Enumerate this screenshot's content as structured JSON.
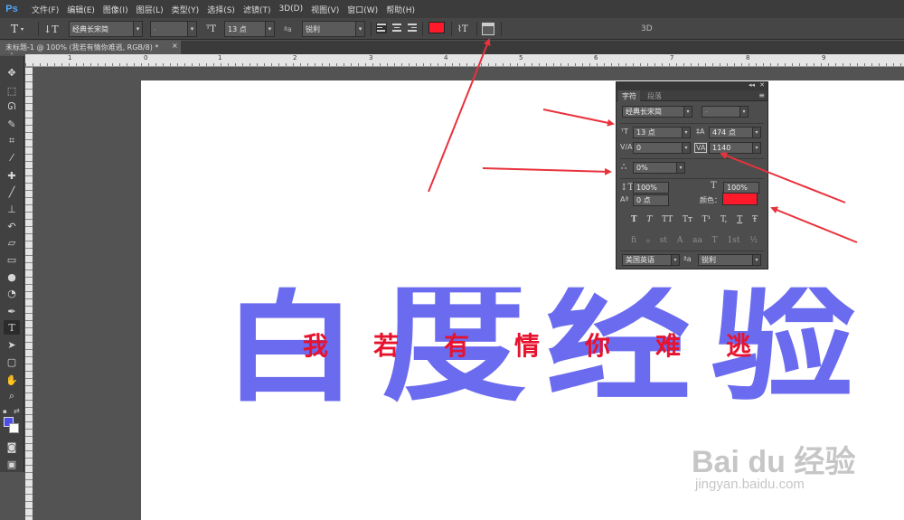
{
  "app": {
    "logo": "Ps"
  },
  "menu": [
    "文件(F)",
    "编辑(E)",
    "图像(I)",
    "图层(L)",
    "类型(Y)",
    "选择(S)",
    "滤镜(T)",
    "3D(D)",
    "视图(V)",
    "窗口(W)",
    "帮助(H)"
  ],
  "options": {
    "font_family": "经典长宋简",
    "font_style": "-",
    "font_size": "13 点",
    "aa_label": "ªa",
    "antialias": "锐利",
    "text_color": "#ff1a2b",
    "three_d": "3D"
  },
  "document": {
    "tab_title": "未标题-1 @ 100% (我若有情你难逃, RGB/8) *",
    "close": "×"
  },
  "ruler": {
    "marks": [
      "1",
      "0",
      "1",
      "2",
      "3",
      "4",
      "5",
      "6",
      "7",
      "8",
      "9"
    ]
  },
  "toolbox": {
    "items": [
      "move",
      "marquee",
      "lasso",
      "quick-select",
      "crop",
      "eyedropper",
      "healing",
      "brush",
      "clone-stamp",
      "history-brush",
      "eraser",
      "gradient",
      "blur",
      "dodge",
      "pen",
      "type",
      "path-select",
      "shape",
      "hand",
      "zoom"
    ],
    "foreground": "#4b4eea",
    "background": "#ffffff"
  },
  "canvas": {
    "big_text": "百度经验",
    "big_text_color": "#6b6bf0",
    "overlay_text": "我若有情你难逃",
    "overlay_text_color": "#e6132e"
  },
  "watermark": {
    "main": "Bai du 经验",
    "sub": "jingyan.baidu.com"
  },
  "panel": {
    "tabs": [
      "字符",
      "段落"
    ],
    "font_family": "经典长宋简",
    "font_style": "-",
    "size": "13 点",
    "leading": "474 点",
    "kerning": "0",
    "tracking": "1140",
    "scale_percent": "0%",
    "vertical_scale": "100%",
    "horizontal_scale": "100%",
    "baseline_shift": "0 点",
    "color_label": "颜色：",
    "color": "#ff1a2b",
    "style_buttons": [
      "T",
      "T",
      "TT",
      "Tт",
      "T¹",
      "T,",
      "T",
      "Ŧ"
    ],
    "opentype_buttons": [
      "fi",
      "ℴ",
      "st",
      "A",
      "aa",
      "T",
      "1st",
      "½"
    ],
    "language": "美国英语",
    "aa_label": "ªa",
    "antialias": "锐利"
  },
  "annotation_color": "#e8323c"
}
